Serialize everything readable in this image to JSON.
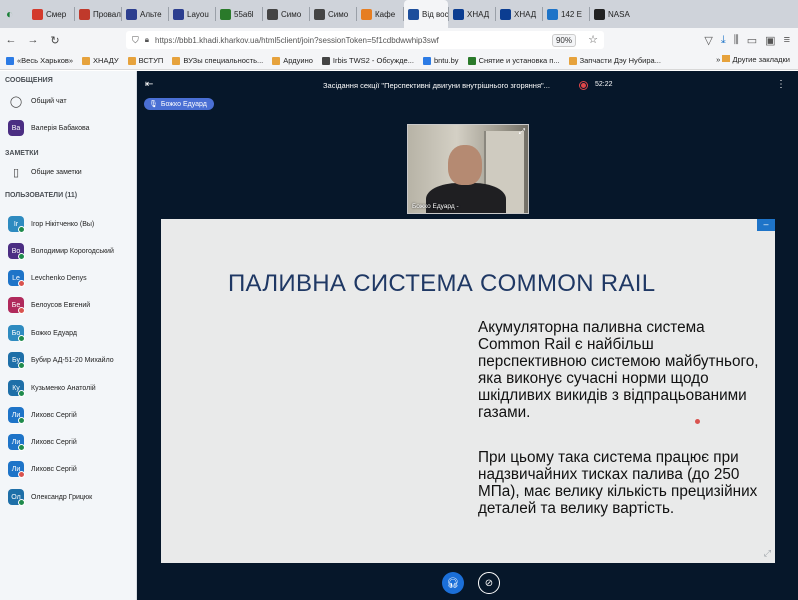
{
  "browser": {
    "tabs": [
      {
        "label": "Смер",
        "color": "#d33a2c"
      },
      {
        "label": "Провал д",
        "color": "#c0392b"
      },
      {
        "label": "Альте",
        "color": "#2c3e8f"
      },
      {
        "label": "Layou",
        "color": "#2c3e8f"
      },
      {
        "label": "55a6l",
        "color": "#2a7a2a"
      },
      {
        "label": "Симо",
        "color": "#444444"
      },
      {
        "label": "Симо",
        "color": "#444444"
      },
      {
        "label": "Кафе",
        "color": "#e67e22"
      },
      {
        "label": "Від вос",
        "color": "#1e4f9c",
        "active": true
      },
      {
        "label": "ХНАД",
        "color": "#0b3d91"
      },
      {
        "label": "ХНАД",
        "color": "#0b3d91"
      },
      {
        "label": "142 Е",
        "color": "#1e74c8"
      },
      {
        "label": "NASA",
        "color": "#222222"
      }
    ],
    "url": "https://bbb1.khadi.kharkov.ua/html5client/join?sessionToken=5f1cdbdwwhip3swf",
    "zoom": "90%",
    "bookmarks": [
      {
        "label": "«Весь Харьков»",
        "color": "#2c7be5"
      },
      {
        "label": "ХНАДУ",
        "color": "#e6a23c"
      },
      {
        "label": "ВСТУП",
        "color": "#e6a23c"
      },
      {
        "label": "ВУЗы специальность...",
        "color": "#e6a23c"
      },
      {
        "label": "Ардуино",
        "color": "#e6a23c"
      },
      {
        "label": "Irbis TWS2 - Обсужде...",
        "color": "#444444"
      },
      {
        "label": "bntu.by",
        "color": "#2c7be5"
      },
      {
        "label": "Снятие и установка п...",
        "color": "#2a7a2a"
      },
      {
        "label": "Запчасти Дэу Нубира...",
        "color": "#e6a23c"
      }
    ],
    "bookmarks_more": "Другие закладки"
  },
  "sidebar": {
    "messages_title": "СООБЩЕНИЯ",
    "public_chat": "Общий чат",
    "private_chat": {
      "initials": "Ва",
      "name": "Валерія Бабакова",
      "color": "#4b2e83"
    },
    "notes_title": "ЗАМЕТКИ",
    "shared_notes": "Общие заметки",
    "users_title": "ПОЛЬЗОВАТЕЛИ (11)",
    "users": [
      {
        "initials": "Ir",
        "name": "Ігор Нікітченко (Вы)",
        "color": "#2e8bc0",
        "badge": "#1f8b4c"
      },
      {
        "initials": "Во",
        "name": "Володимир Корогодський",
        "color": "#4b2e83",
        "badge": "#1f8b4c"
      },
      {
        "initials": "Le",
        "name": "Levchenko Denys",
        "color": "#1e74c8",
        "badge": "#d9534f"
      },
      {
        "initials": "Бе",
        "name": "Белоусов Евгений",
        "color": "#b02a5c",
        "badge": "#d9534f"
      },
      {
        "initials": "Бо",
        "name": "Божко Едуард",
        "color": "#2e8bc0",
        "badge": "#1f8b4c"
      },
      {
        "initials": "Бу",
        "name": "Бубир АД-51-20 Михайло",
        "color": "#1e6fa8",
        "badge": "#1f8b4c"
      },
      {
        "initials": "Ку",
        "name": "Кузьменко Анатолій",
        "color": "#1e6fa8",
        "badge": "#1f8b4c"
      },
      {
        "initials": "Ли",
        "name": "Лиховс Сергій",
        "color": "#1e74c8",
        "badge": "#1f8b4c"
      },
      {
        "initials": "Ли",
        "name": "Лиховс Сергій",
        "color": "#1e74c8",
        "badge": "#1f8b4c"
      },
      {
        "initials": "Ли",
        "name": "Лиховс Сергій",
        "color": "#1e74c8",
        "badge": "#d9534f"
      },
      {
        "initials": "Ол",
        "name": "Олександр Грицюк",
        "color": "#1e6fa8",
        "badge": "#1f8b4c"
      }
    ]
  },
  "meeting": {
    "title": "Засідання секції \"Перспективні двигуни внутрішнього згоряння\"...",
    "timer": "52:22",
    "talker": "Божко Едуард",
    "camera_name": "Божко Едуард -"
  },
  "slide": {
    "title": "ПАЛИВНА СИСТЕМА COMMON RAIL",
    "p1": "Акумуляторна паливна система Common Rail є найбільш перспективною системою майбутнього, яка виконує сучасні норми щодо шкідливих викидів з відпрацьованими газами.",
    "p2": "При цьому така система працює при надзвичайних тисках палива (до 250 МПа), має велику кількість прецизійних деталей та велику вартість."
  }
}
